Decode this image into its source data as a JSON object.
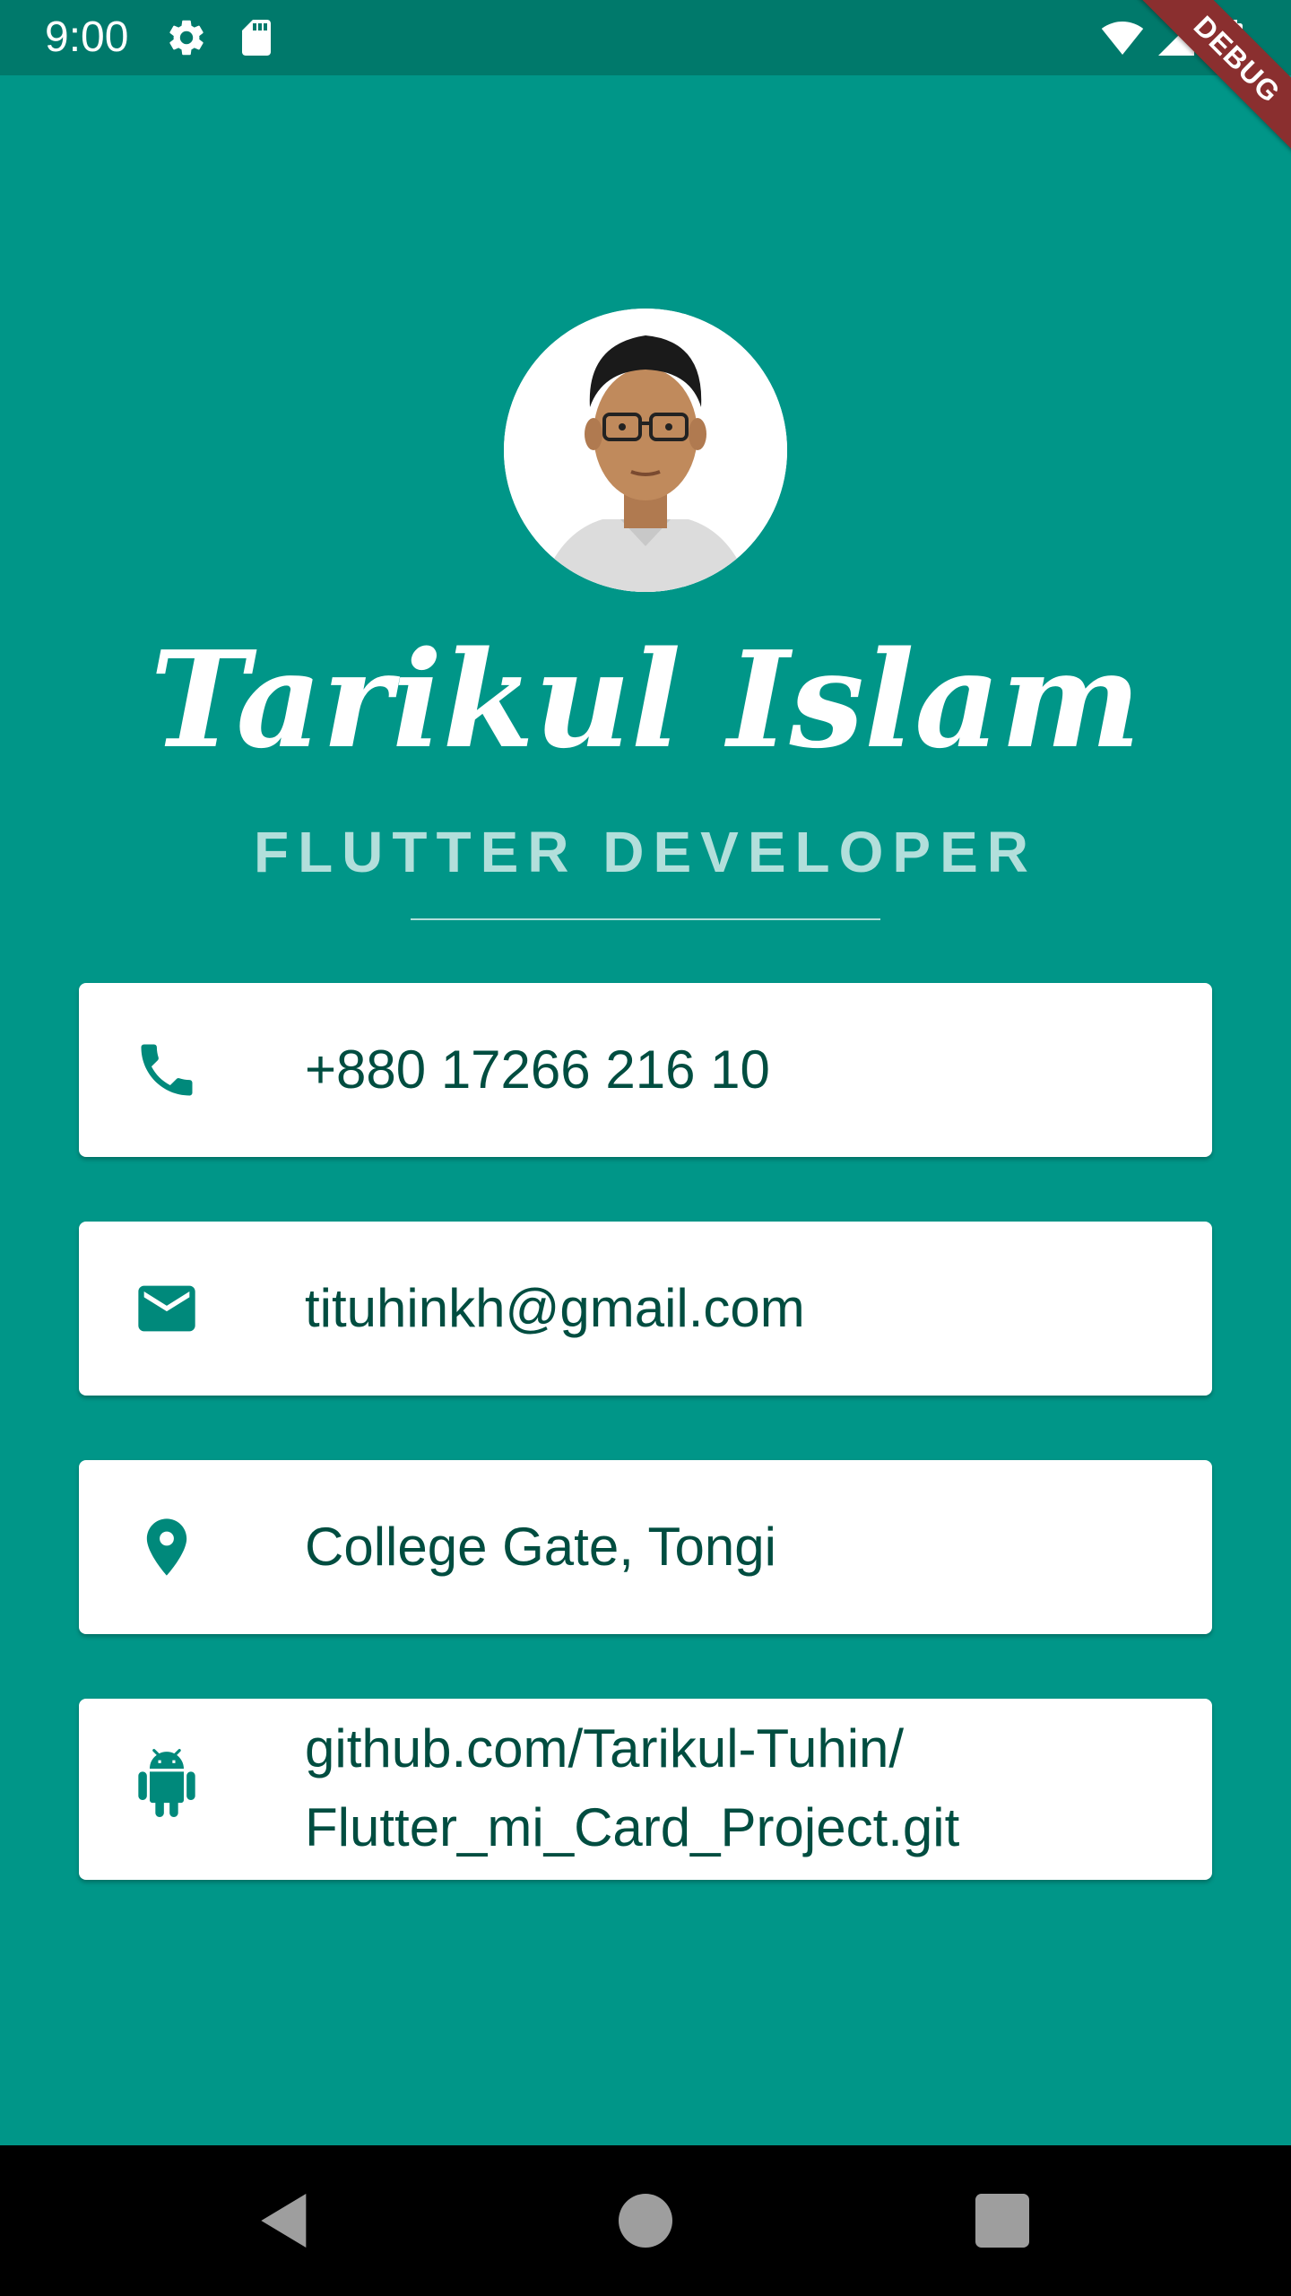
{
  "status_bar": {
    "time": "9:00",
    "icons": [
      "gear-icon",
      "sd-card-icon",
      "wifi-icon",
      "signal-icon",
      "battery-icon"
    ],
    "debug_label": "DEBUG",
    "background": "#00796b"
  },
  "profile": {
    "name": "Tarikul Islam",
    "title": "FLUTTER DEVELOPER",
    "avatar_icon": "profile-photo"
  },
  "contacts": [
    {
      "icon": "phone-icon",
      "text": "+880 17266 216 10"
    },
    {
      "icon": "email-icon",
      "text": "tituhinkh@gmail.com"
    },
    {
      "icon": "location-icon",
      "text": "College Gate, Tongi"
    },
    {
      "icon": "android-icon",
      "text_line1": "github.com/Tarikul-Tuhin/",
      "text_line2": "Flutter_mi_Card_Project.git"
    }
  ],
  "nav_bar": {
    "buttons": [
      "back-icon",
      "home-icon",
      "recents-icon"
    ]
  },
  "colors": {
    "background": "#009688",
    "accent": "#b2dfdb",
    "card_text": "#004d40",
    "icon": "#00897b",
    "debug_banner": "#8a2f2f"
  }
}
